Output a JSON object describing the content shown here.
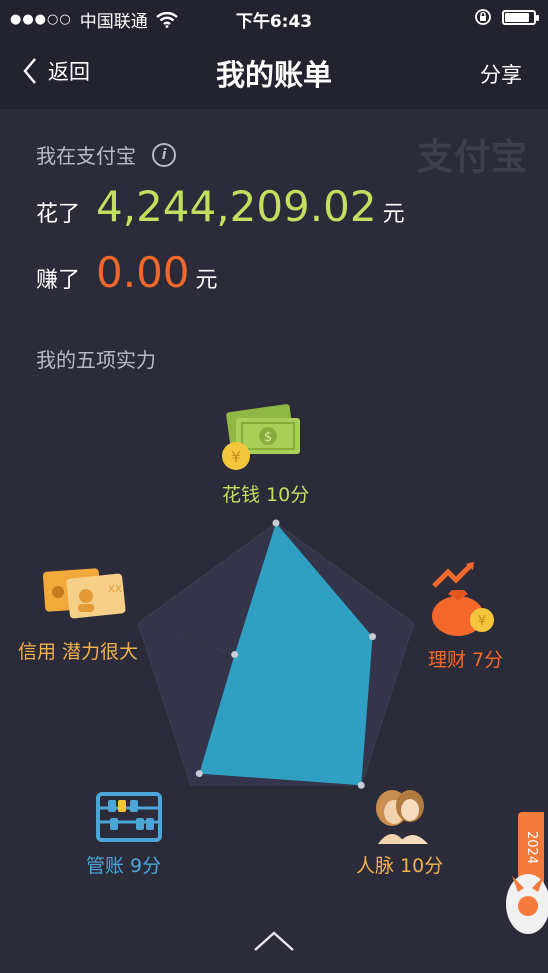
{
  "status_bar": {
    "signal_dots": "●●●○○",
    "carrier": "中国联通",
    "time": "下午6:43"
  },
  "nav": {
    "back_label": "返回",
    "title": "我的账单",
    "share_label": "分享"
  },
  "summary": {
    "heading": "我在支付宝",
    "info_icon": "i",
    "logo_text": "支付宝",
    "spent_label": "花了",
    "spent_amount": "4,244,209.02",
    "spent_unit": "元",
    "earned_label": "赚了",
    "earned_amount": "0.00",
    "earned_unit": "元"
  },
  "abilities": {
    "section_title": "我的五项实力",
    "spend": "花钱 10分",
    "credit": "信用 潜力很大",
    "finance": "理财 7分",
    "account": "管账 9分",
    "contacts": "人脉 10分"
  },
  "radar": {
    "scores": [
      10,
      7,
      10,
      9,
      3
    ],
    "max": 10,
    "fill_color": "#2fa6c8",
    "axis_order": [
      "花钱",
      "理财",
      "人脉",
      "管账",
      "信用"
    ]
  },
  "float_tab": "2024",
  "colors": {
    "background": "#2b2b3a",
    "spent": "#c3df5f",
    "earned": "#f2672a",
    "radar_fill": "#2fa6c8"
  }
}
